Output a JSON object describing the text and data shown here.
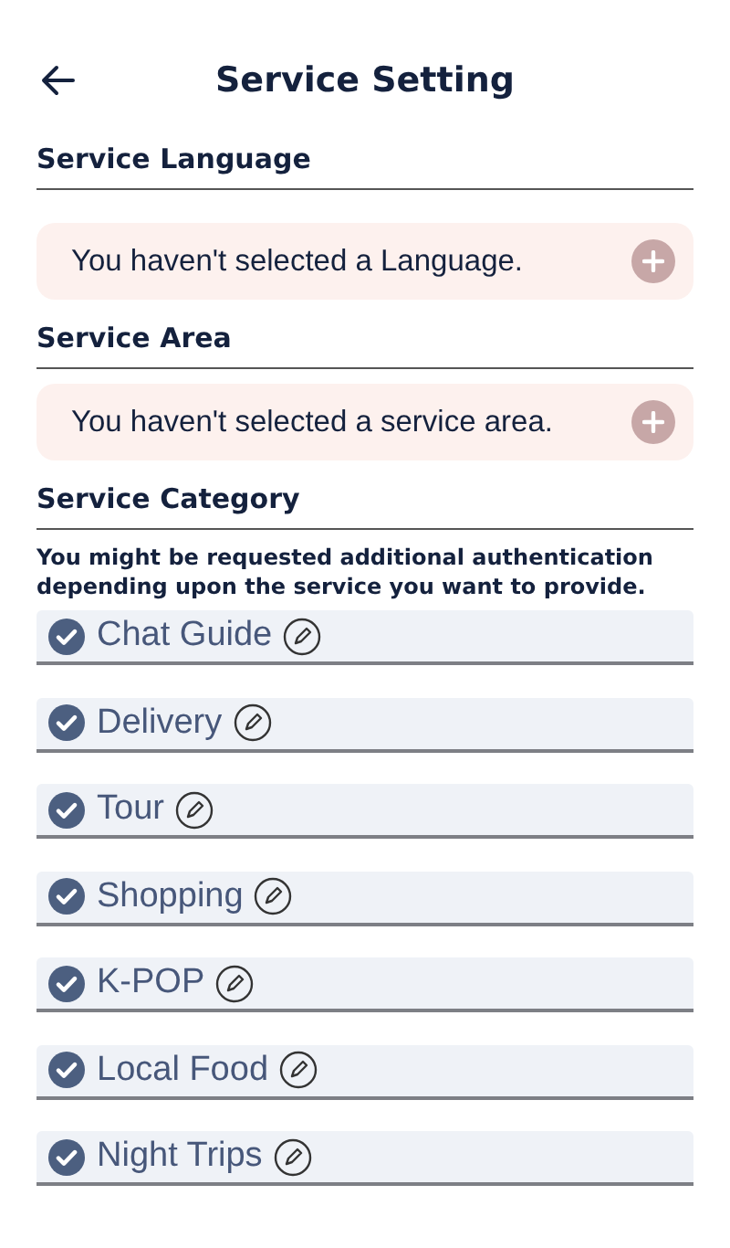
{
  "header": {
    "title": "Service Setting"
  },
  "sections": [
    {
      "title": "Service Language",
      "kind": "empty",
      "message": "You haven't selected a Language."
    },
    {
      "title": "Service Area",
      "kind": "empty",
      "message": "You haven't selected a service area."
    },
    {
      "title": "Service Category",
      "kind": "categories",
      "note": "You might be requested additional authentication depending upon the service you want to provide.",
      "items": [
        {
          "label": "Chat Guide",
          "checked": true
        },
        {
          "label": "Delivery",
          "checked": true
        },
        {
          "label": "Tour",
          "checked": true
        },
        {
          "label": "Shopping",
          "checked": true
        },
        {
          "label": "K-POP",
          "checked": true
        },
        {
          "label": "Local Food",
          "checked": true
        },
        {
          "label": "Night Trips",
          "checked": true
        }
      ]
    }
  ]
}
